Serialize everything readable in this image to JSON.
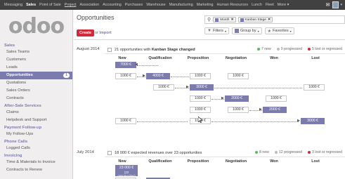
{
  "topbar": {
    "menus": [
      "Messaging",
      "Sales",
      "Point of Sale",
      "Project",
      "Association",
      "Accounting",
      "Purchases",
      "Warehouse",
      "Manufacturing",
      "Marketing",
      "Human Resources",
      "Lunch",
      "Fleet"
    ],
    "more": "More",
    "more_caret": "▾",
    "chat_icon": "chat-bubble-icon",
    "avatar_icon": "user-avatar-icon",
    "active_menu": "Sales",
    "underlined_menu": "Project"
  },
  "logo": "odoo",
  "sidebar": {
    "sections": [
      {
        "title": "Sales",
        "items": [
          "Sales Teams",
          "Customers",
          "Leads",
          "Opportunities",
          "Quotations",
          "Sales Orders",
          "Contracts"
        ]
      },
      {
        "title": "After-Sale Services",
        "items": [
          "Claims",
          "Helpdesk and Support"
        ]
      },
      {
        "title": "Payment Follow-up",
        "items": [
          "My Follow-Ups"
        ]
      },
      {
        "title": "Phone Calls",
        "items": [
          "Logged Calls"
        ]
      },
      {
        "title": "Invoicing",
        "items": [
          "Time & Materials to Invoice",
          "Contracts to Renew"
        ]
      }
    ],
    "active_item": "Opportunities",
    "active_badge": "1"
  },
  "main": {
    "title": "Opportunities",
    "create_label": "Create",
    "or_label": "or",
    "import_label": "Import",
    "search_facets": [
      "Month",
      "Kanban Stage"
    ],
    "filters_label": "Filters",
    "groupby_label": "Group by",
    "favorites_label": "Favorites",
    "columns": [
      "New",
      "Qualification",
      "Proposition",
      "Negotiation",
      "Won",
      "Lost"
    ]
  },
  "cohorts": [
    {
      "month": "August 2014",
      "summary_prefix": "21 opportunities with",
      "summary_bold": "Kanban Stage changed",
      "stats": [
        {
          "label": "7 new",
          "color": "#5cb85c"
        },
        {
          "label": "0 progressed",
          "color": "#bbbbbb"
        },
        {
          "label": "5 lost or regressed",
          "color": "#d2293a"
        }
      ]
    },
    {
      "month": "July 2014",
      "summary_prefix": "18 000 € expected revenues over 23 opportunities",
      "summary_bold": "",
      "stats": [
        {
          "label": "8 new",
          "color": "#5cb85c"
        },
        {
          "label": "12 progressed",
          "color": "#bbbbbb"
        },
        {
          "label": "3 lost or regressed",
          "color": "#d2293a"
        }
      ]
    }
  ],
  "rows": [
    {
      "value": "7000 €",
      "start": 0,
      "end": 0,
      "highlight": [
        0
      ],
      "arrows": [],
      "boxes": [
        0
      ]
    },
    {
      "value": "1000 €",
      "highlight": [
        1
      ],
      "boxes": [
        0,
        1,
        2,
        3
      ]
    },
    {
      "value": "1000 €",
      "highlight": [
        2
      ],
      "boxes": [
        1,
        2,
        5
      ]
    },
    {
      "value": "1000 €",
      "highlight": [
        3
      ],
      "boxes": [
        2,
        3,
        4
      ]
    },
    {
      "value": "1000 €",
      "highlight": [
        4
      ],
      "boxes": [
        2,
        3,
        4
      ]
    },
    {
      "value": "1000 €",
      "highlight": [
        5
      ],
      "boxes": [
        0,
        2,
        5
      ]
    }
  ],
  "row_values": {
    "r1": [
      "7000 €"
    ],
    "r2": [
      "1000 €",
      "4000 €",
      "1000 €",
      "1000 €"
    ],
    "r3": [
      "1000 €",
      "3000 €",
      "1000 €"
    ],
    "r4": [
      "1000 €",
      "2000 €",
      "1000 €"
    ],
    "r5": [
      "1000 €",
      "1000 €",
      "2000 €"
    ],
    "r6": [
      "1000 €",
      "1000 €",
      "3000 €"
    ]
  },
  "july_new": "23 000 €",
  "july_new_sub": "(23 opportunities)"
}
